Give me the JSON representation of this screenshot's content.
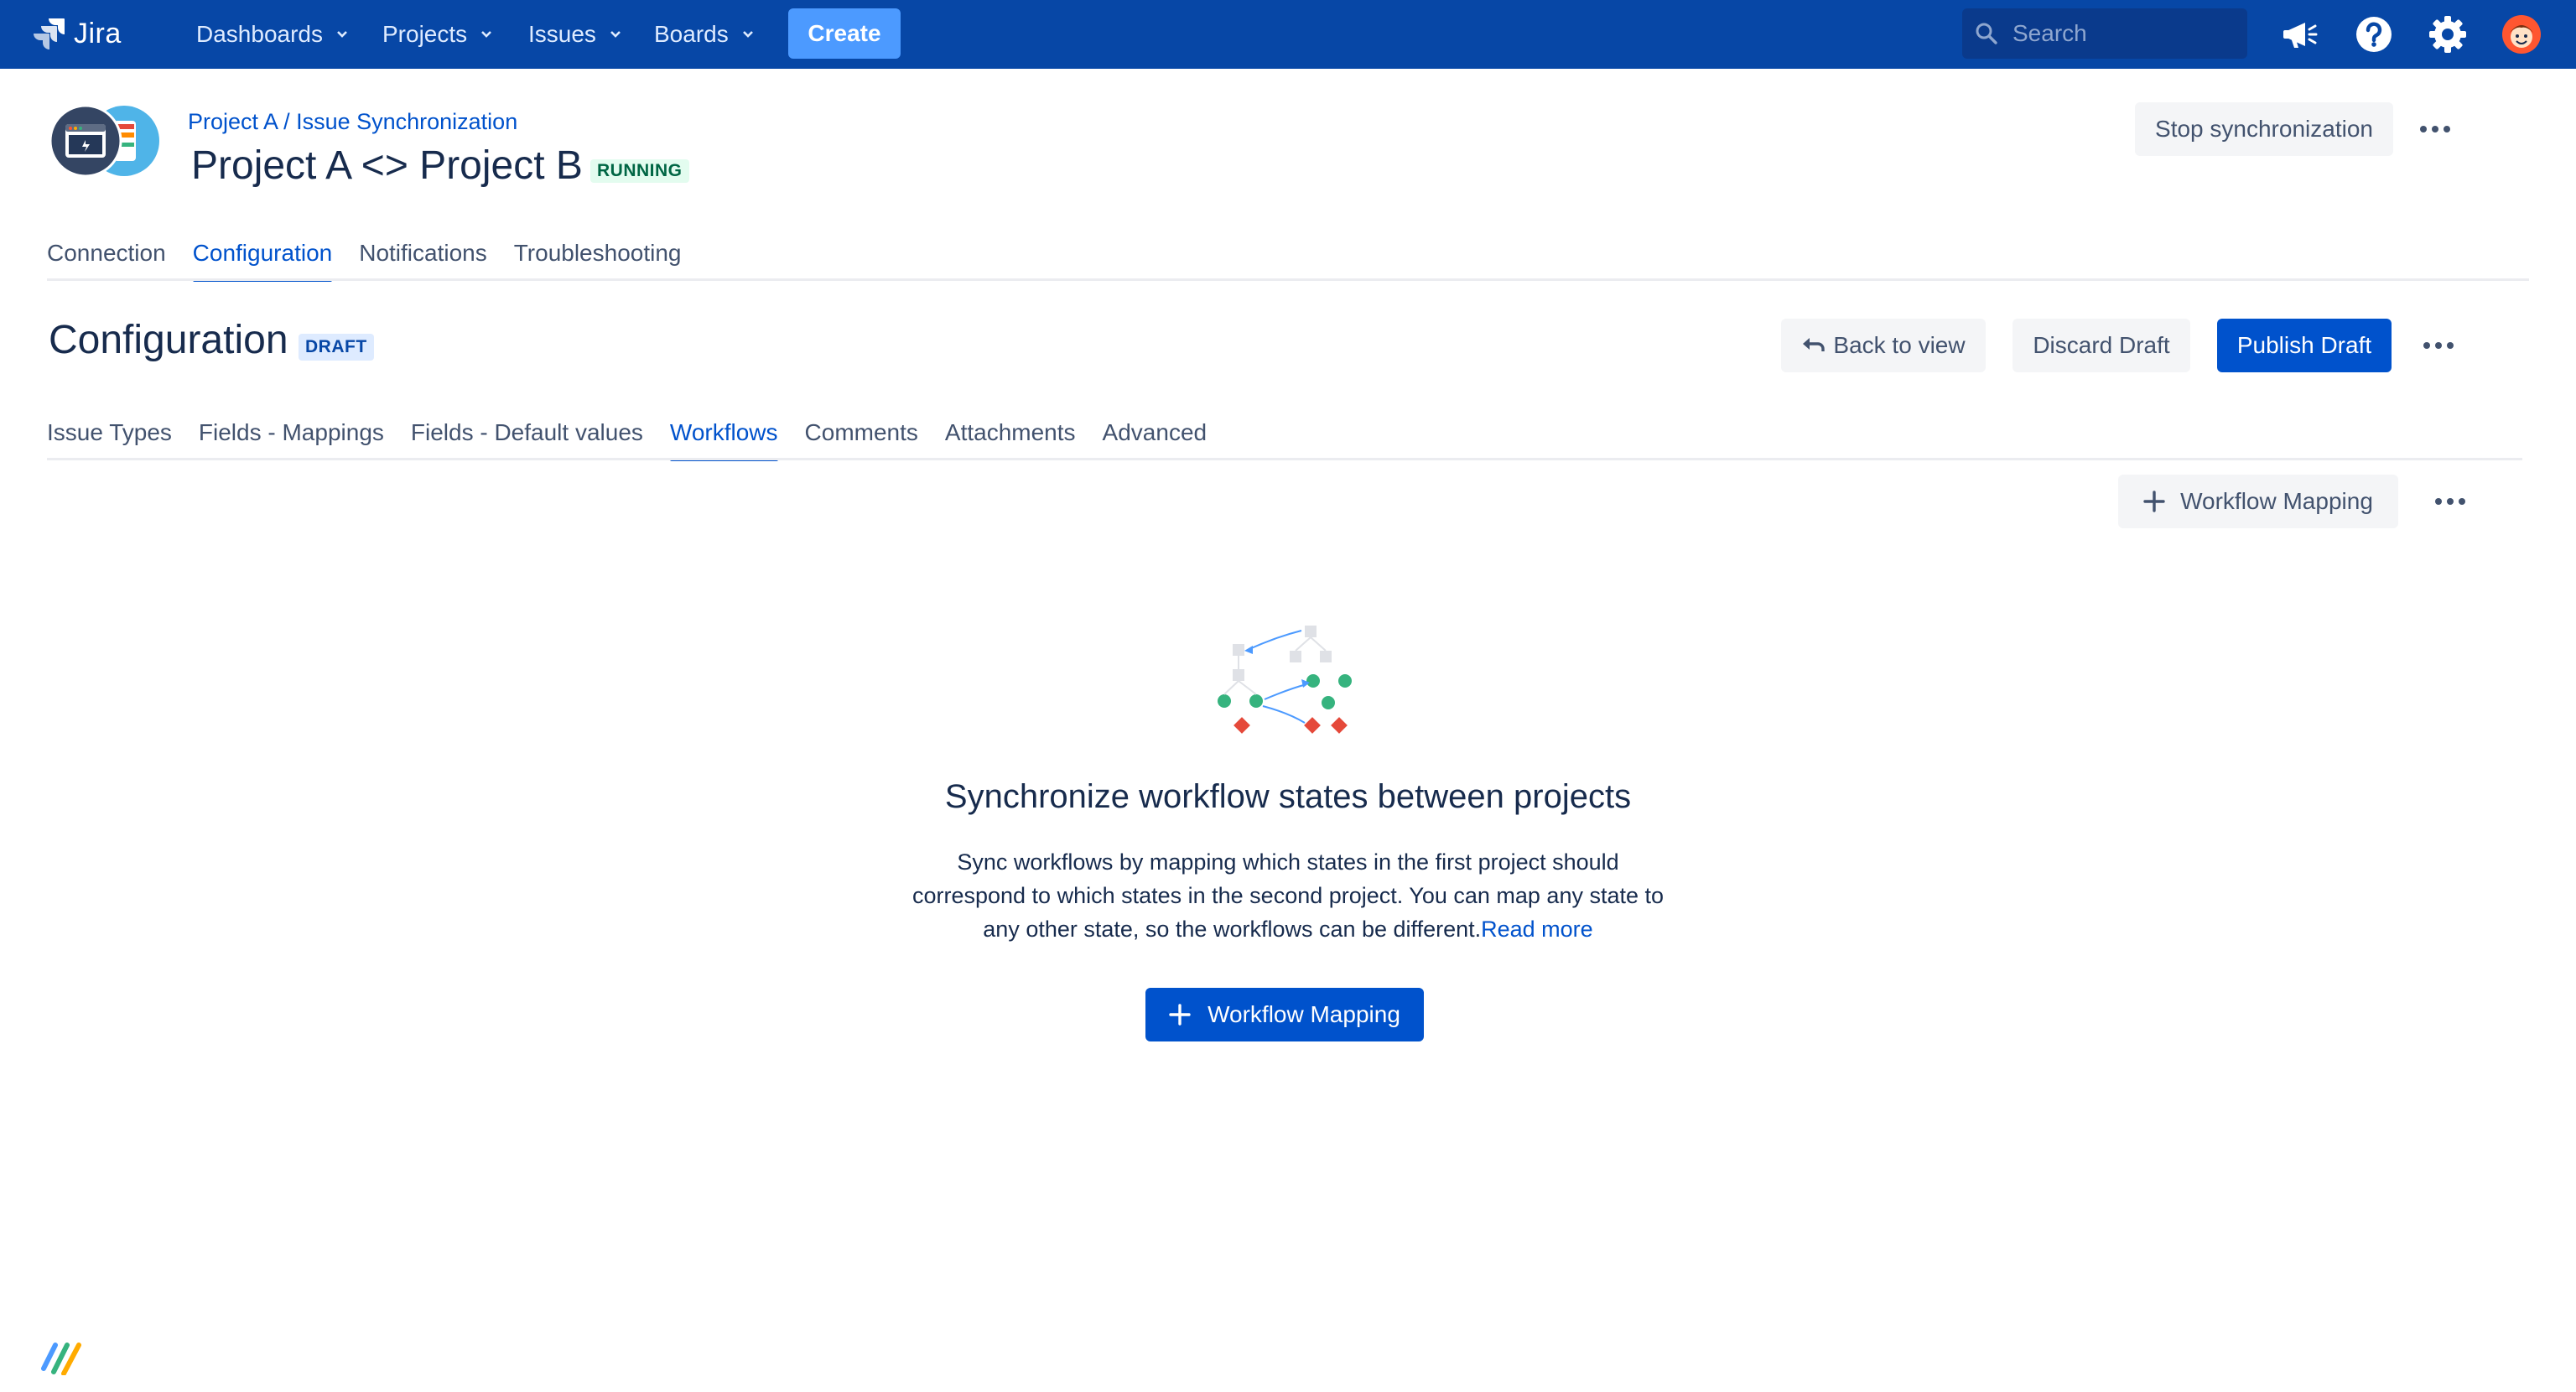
{
  "topnav": {
    "app_name": "Jira",
    "menu": [
      {
        "label": "Dashboards"
      },
      {
        "label": "Projects"
      },
      {
        "label": "Issues"
      },
      {
        "label": "Boards"
      }
    ],
    "create_label": "Create",
    "search_placeholder": "Search",
    "icons": [
      "megaphone-icon",
      "help-icon",
      "settings-icon",
      "user-avatar"
    ]
  },
  "project": {
    "breadcrumb": "Project A / Issue Synchronization",
    "title": "Project A <> Project B",
    "status": "RUNNING",
    "stop_label": "Stop synchronization"
  },
  "main_tabs": [
    {
      "label": "Connection",
      "active": false
    },
    {
      "label": "Configuration",
      "active": true
    },
    {
      "label": "Notifications",
      "active": false
    },
    {
      "label": "Troubleshooting",
      "active": false
    }
  ],
  "config": {
    "title": "Configuration",
    "status": "DRAFT",
    "back_label": "Back to view",
    "discard_label": "Discard Draft",
    "publish_label": "Publish Draft"
  },
  "sub_tabs": [
    {
      "label": "Issue Types",
      "active": false
    },
    {
      "label": "Fields - Mappings",
      "active": false
    },
    {
      "label": "Fields - Default values",
      "active": false
    },
    {
      "label": "Workflows",
      "active": true
    },
    {
      "label": "Comments",
      "active": false
    },
    {
      "label": "Attachments",
      "active": false
    },
    {
      "label": "Advanced",
      "active": false
    }
  ],
  "workflows": {
    "add_mapping_label": "Workflow Mapping",
    "empty_title": "Synchronize workflow states between projects",
    "empty_desc": "Sync workflows by mapping which states in the first project should correspond to which states in the second project. You can map any state to any other state, so the workflows can be different.",
    "read_more": "Read more",
    "cta_label": "Workflow Mapping"
  },
  "colors": {
    "nav_bg": "#0747a6",
    "primary": "#0052cc",
    "create_btn": "#4c9aff",
    "teal": "#36b37e",
    "red": "#e5493a"
  }
}
